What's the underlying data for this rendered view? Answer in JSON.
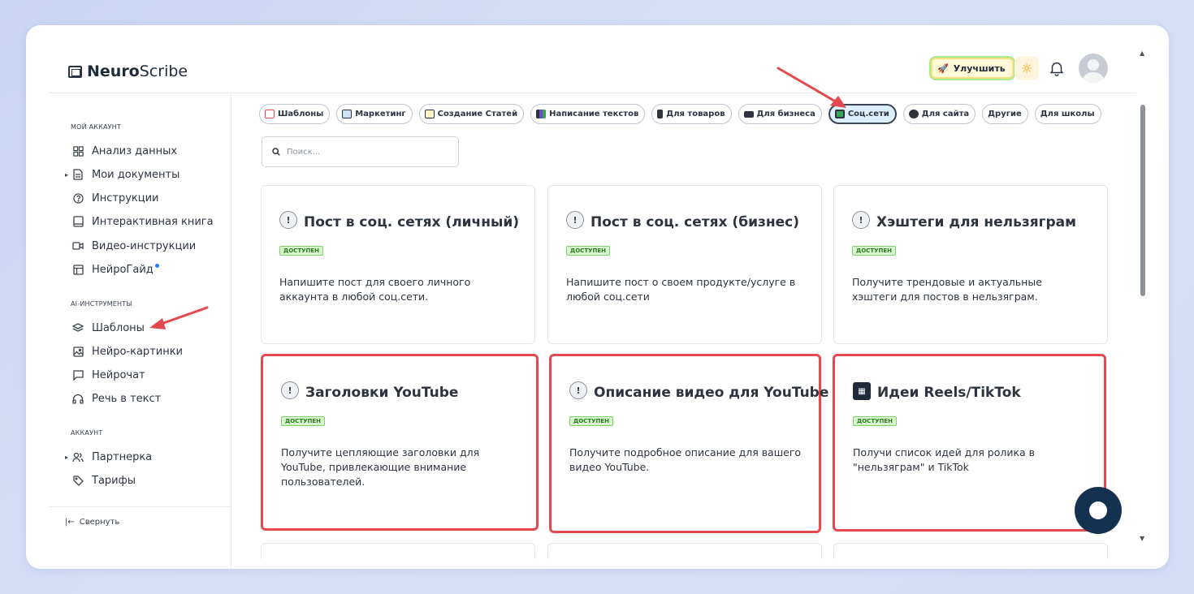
{
  "app": {
    "brand_bold": "Neuro",
    "brand_rest": "Scribe"
  },
  "header": {
    "upgrade_label": "Улучшить"
  },
  "sidebar": {
    "sections": [
      {
        "title": "Мой аккаунт",
        "items": [
          {
            "label": "Анализ данных",
            "icon": "grid-icon"
          },
          {
            "label": "Мои документы",
            "icon": "document-icon",
            "expandable": true
          },
          {
            "label": "Инструкции",
            "icon": "help-icon"
          },
          {
            "label": "Интерактивная книга",
            "icon": "book-icon"
          },
          {
            "label": "Видео-инструкции",
            "icon": "video-icon"
          },
          {
            "label": "НейроГайд",
            "icon": "guide-icon",
            "new_dot": true
          }
        ]
      },
      {
        "title": "AI-инструменты",
        "items": [
          {
            "label": "Шаблоны",
            "icon": "layers-icon"
          },
          {
            "label": "Нейро-картинки",
            "icon": "image-icon"
          },
          {
            "label": "Нейрочат",
            "icon": "chat-icon"
          },
          {
            "label": "Речь в текст",
            "icon": "headphones-icon"
          }
        ]
      },
      {
        "title": "Аккаунт",
        "items": [
          {
            "label": "Партнерка",
            "icon": "users-icon",
            "expandable": true
          },
          {
            "label": "Тарифы",
            "icon": "tag-icon"
          }
        ]
      }
    ],
    "collapse_label": "Свернуть"
  },
  "tabs": [
    {
      "label": "Шаблоны",
      "icon_color": "#e5484d"
    },
    {
      "label": "Маркетинг",
      "icon_color": "#8a919c"
    },
    {
      "label": "Создание Статей",
      "icon_color": "#f0b400"
    },
    {
      "label": "Написание текстов",
      "icon_color": "#6b4fbb"
    },
    {
      "label": "Для товаров",
      "icon_color": "#2d3440"
    },
    {
      "label": "Для бизнеса",
      "icon_color": "#2d3440"
    },
    {
      "label": "Соц.сети",
      "icon_color": "#3aa35a",
      "active": true
    },
    {
      "label": "Для сайта",
      "icon_color": "#2d3440"
    },
    {
      "label": "Другие"
    },
    {
      "label": "Для школы"
    }
  ],
  "search": {
    "placeholder": "Поиск..."
  },
  "cards": [
    {
      "title": "Пост в соц. сетях (личный)",
      "badge": "доступен",
      "desc": "Напишите пост для своего личного аккаунта в любой соц.сети.",
      "icon": "info-icon",
      "highlighted": false
    },
    {
      "title": "Пост в соц. сетях (бизнес)",
      "badge": "доступен",
      "desc": "Напишите пост о своем продукте/услуге в любой соц.сети",
      "icon": "info-icon",
      "highlighted": false
    },
    {
      "title": "Хэштеги для нельзяграм",
      "badge": "доступен",
      "desc": "Получите трендовые и актуальные хэштеги для постов в нельзяграм.",
      "icon": "info-icon",
      "highlighted": false
    },
    {
      "title": "Заголовки YouTube",
      "badge": "доступен",
      "desc": "Получите цепляющие заголовки для YouTube, привлекающие внимание пользователей.",
      "icon": "info-icon",
      "highlighted": true
    },
    {
      "title": "Описание видео для YouTube",
      "badge": "доступен",
      "desc": "Получите подробное описание для вашего видео YouTube.",
      "icon": "info-icon",
      "highlighted": true
    },
    {
      "title": "Идеи Reels/TikTok",
      "badge": "доступен",
      "desc": "Получи список идей для ролика в \"нельзяграм\" и TikTok",
      "icon": "film-icon",
      "highlighted": true
    }
  ],
  "colors": {
    "highlight": "#e5484d",
    "arrow": "#e5484d",
    "active_tab_bg": "#dcefff",
    "badge_bg": "#d6f5cc"
  }
}
